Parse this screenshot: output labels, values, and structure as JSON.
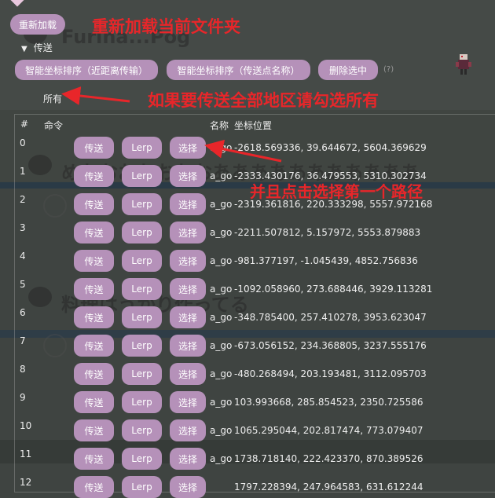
{
  "background": {
    "ghost_texts": [
      "Furina...Pog",
      "めおおおおおおおあああああああああああ",
      "料理はうかり作ってる"
    ]
  },
  "header": {
    "reload_button": "重新加载",
    "tree_node": "传送",
    "all_option": "所有",
    "hint": "(?)"
  },
  "toolbar": {
    "sort_nearest": "智能坐标排序（近距离传输）",
    "sort_name": "智能坐标排序（传送点名称）",
    "delete_selected": "删除选中"
  },
  "table": {
    "headers": {
      "index": "#",
      "command": "命令",
      "name": "名称",
      "coords": "坐标位置"
    },
    "button_labels": {
      "teleport": "传送",
      "lerp": "Lerp",
      "select": "选择"
    },
    "rows": [
      {
        "index": "0",
        "name": "a_go",
        "coords": "-2618.569336, 39.644672, 5604.369629"
      },
      {
        "index": "1",
        "name": "a_go",
        "coords": "-2333.430176, 36.479553, 5310.302734"
      },
      {
        "index": "2",
        "name": "a_go",
        "coords": "-2319.361816, 220.333298, 5557.972168"
      },
      {
        "index": "3",
        "name": "a_go",
        "coords": "-2211.507812, 5.157972, 5553.879883"
      },
      {
        "index": "4",
        "name": "a_go",
        "coords": "-981.377197, -1.045439, 4852.756836"
      },
      {
        "index": "5",
        "name": "a_go",
        "coords": "-1092.058960, 273.688446, 3929.113281"
      },
      {
        "index": "6",
        "name": "a_go",
        "coords": "-348.785400, 257.410278, 3953.623047"
      },
      {
        "index": "7",
        "name": "a_go",
        "coords": "-673.056152, 234.368805, 3237.555176"
      },
      {
        "index": "8",
        "name": "a_go",
        "coords": "-480.268494, 203.193481, 3112.095703"
      },
      {
        "index": "9",
        "name": "a_go",
        "coords": "103.993668, 285.854523, 2350.725586"
      },
      {
        "index": "10",
        "name": "a_go",
        "coords": "1065.295044, 202.817474, 773.079407"
      },
      {
        "index": "11",
        "name": "a_go",
        "coords": "1738.718140, 222.423370, 870.389526"
      },
      {
        "index": "12",
        "name": "",
        "coords": "1797.228394, 247.964583, 631.612244"
      }
    ]
  },
  "annotations": {
    "reload": "重新加载当前文件夹",
    "select_all": "如果要传送全部地区请勾选所有",
    "click_select": "并且点击选择第一个路径"
  },
  "colors": {
    "button": "#b591b9",
    "annotation": "#e8262a",
    "background": "#3f4441"
  }
}
